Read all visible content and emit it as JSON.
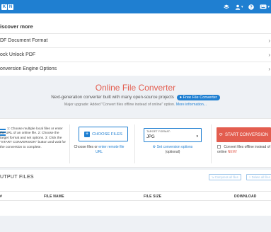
{
  "topbar": {
    "logo_letters": [
      "K",
      "N"
    ],
    "icons": [
      "layers-icon",
      "user-icon",
      "help-icon",
      "keyboard-icon"
    ],
    "bg_color": "#1f7fd1"
  },
  "discover": {
    "title": "iscover more",
    "items": [
      {
        "label": "DF Document Format"
      },
      {
        "label": "ock Unlock PDF"
      },
      {
        "label": "onversion Engine Options"
      }
    ]
  },
  "hero": {
    "title": "Online File Converter",
    "subtitle": "Next-generation converter built with many open-source projects",
    "pill": "Free File Converter",
    "note_prefix": "Major upgrade: Added \"Convert files offline instead of online\" option.",
    "note_link": "More information..."
  },
  "converter": {
    "steps_text": "1: Choose multiple local files or enter the URL of an online file. 2: Choose the target format and set options. 3: Click the \"START CONVERSION\" button and wait for the conversion to complete.",
    "choose_button": "CHOOSE FILES",
    "choose_help_prefix": "Choose files or",
    "choose_help_link": "enter remote file URL",
    "format_label": "TARGET FORMAT:",
    "format_value": "JPG",
    "options_link": "Set conversion options",
    "options_note": "(optional)",
    "start_button": "START CONVERSION",
    "offline_text": "Convert files offline instead of online",
    "offline_new": "NEW!",
    "accent_color": "#e35d4f"
  },
  "output": {
    "title": "UTPUT FILES",
    "compress_button": "Compress all files",
    "delete_button": "Delete all files",
    "columns": [
      "#",
      "FILE NAME",
      "FILE SIZE",
      "DOWNLOAD"
    ]
  }
}
